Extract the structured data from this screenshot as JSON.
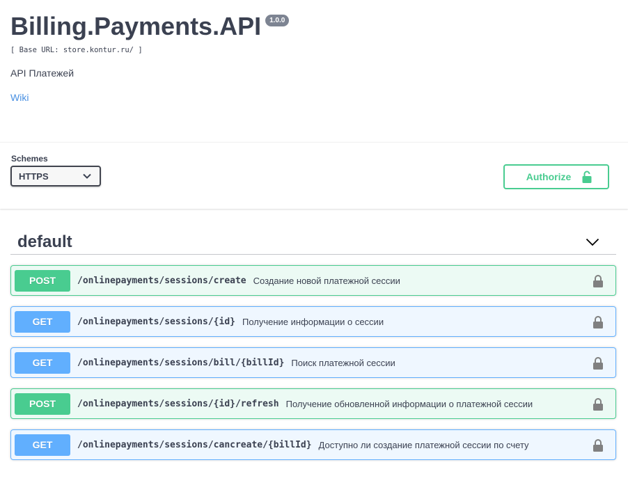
{
  "info": {
    "title": "Billing.Payments.API",
    "version": "1.0.0",
    "base_url": "[ Base URL: store.kontur.ru/ ]",
    "description": "API Платежей",
    "wiki_label": "Wiki"
  },
  "schemes": {
    "label": "Schemes",
    "selected": "HTTPS"
  },
  "authorize": {
    "label": "Authorize"
  },
  "tag": {
    "name": "default"
  },
  "operations": [
    {
      "method": "POST",
      "path": "/onlinepayments/sessions/create",
      "summary": "Создание новой платежной сессии"
    },
    {
      "method": "GET",
      "path": "/onlinepayments/sessions/{id}",
      "summary": "Получение информации о сессии"
    },
    {
      "method": "GET",
      "path": "/onlinepayments/sessions/bill/{billId}",
      "summary": "Поиск платежной сессии"
    },
    {
      "method": "POST",
      "path": "/onlinepayments/sessions/{id}/refresh",
      "summary": "Получение обновленной информации о платежной сессии"
    },
    {
      "method": "GET",
      "path": "/onlinepayments/sessions/cancreate/{billId}",
      "summary": "Доступно ли создание платежной сессии по счету"
    }
  ],
  "colors": {
    "post": "#49cc90",
    "get": "#61afe",
    "text": "#3b4151",
    "link": "#4990e2"
  }
}
